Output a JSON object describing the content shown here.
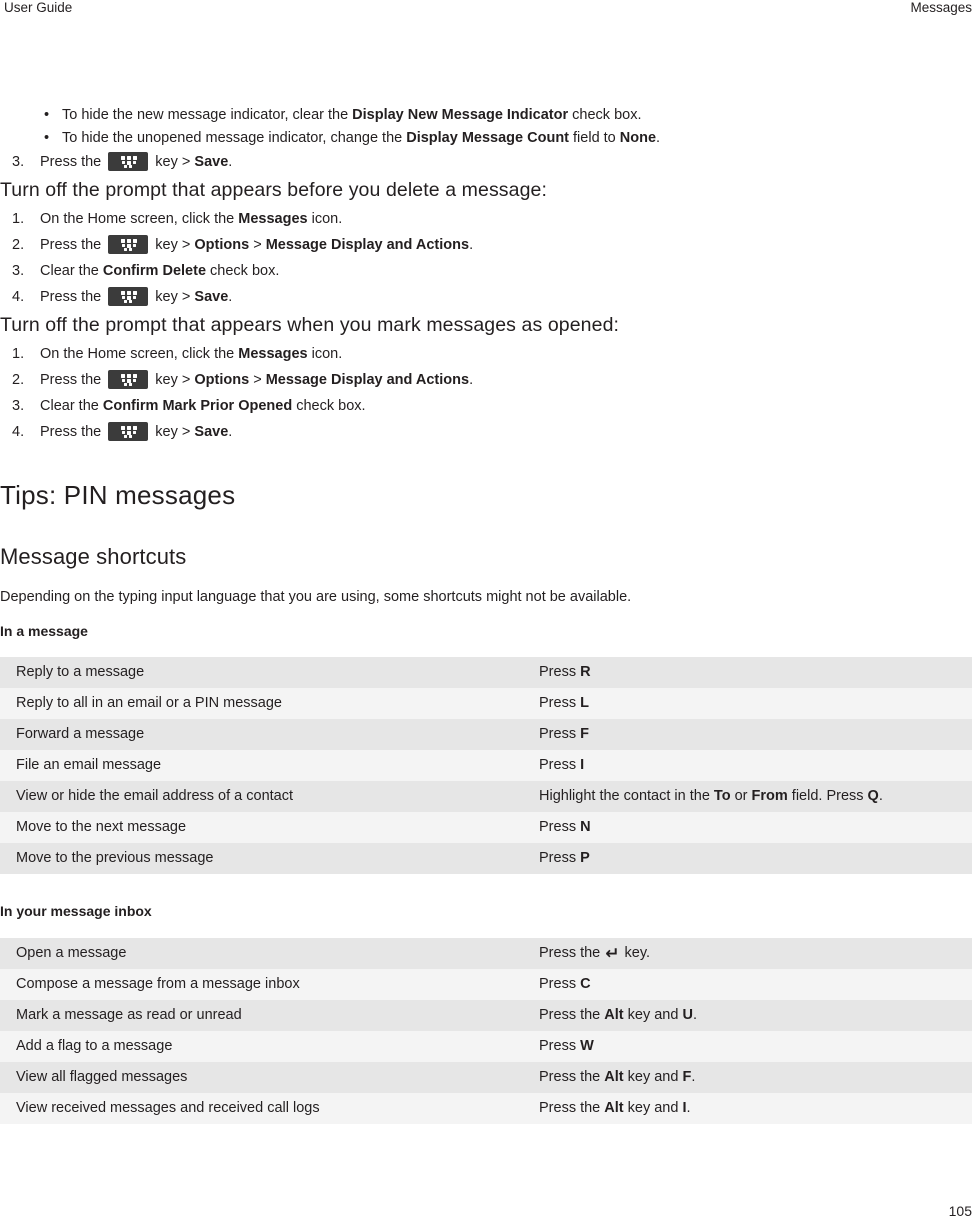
{
  "runhead": {
    "left": "User Guide",
    "right": "Messages"
  },
  "intro_bullets": [
    {
      "pre": "To hide the new message indicator, clear the ",
      "bold": "Display New Message Indicator",
      "post": " check box."
    },
    {
      "pre": "To hide the unopened message indicator, change the ",
      "bold": "Display Message Count",
      "mid": " field to ",
      "bold2": "None",
      "post": "."
    }
  ],
  "intro_step": {
    "num": "3.",
    "pre": "Press the ",
    "icon": "blackberry-menu-key-icon",
    "mid": " key > ",
    "bold": "Save",
    "post": "."
  },
  "procedures": [
    {
      "heading": "Turn off the prompt that appears before you delete a message:",
      "steps": [
        {
          "num": "1.",
          "pre": "On the Home screen, click the ",
          "bold": "Messages",
          "post": " icon.",
          "icon": false
        },
        {
          "num": "2.",
          "pre": "Press the ",
          "icon": true,
          "mid": " key > ",
          "bold": "Options",
          "mid2": " > ",
          "bold2": "Message Display and Actions",
          "post": "."
        },
        {
          "num": "3.",
          "pre": "Clear the ",
          "bold": "Confirm Delete",
          "post": " check box.",
          "icon": false
        },
        {
          "num": "4.",
          "pre": "Press the ",
          "icon": true,
          "mid": " key > ",
          "bold": "Save",
          "post": "."
        }
      ]
    },
    {
      "heading": "Turn off the prompt that appears when you mark messages as opened:",
      "steps": [
        {
          "num": "1.",
          "pre": "On the Home screen, click the ",
          "bold": "Messages",
          "post": " icon.",
          "icon": false
        },
        {
          "num": "2.",
          "pre": "Press the ",
          "icon": true,
          "mid": " key > ",
          "bold": "Options",
          "mid2": " > ",
          "bold2": "Message Display and Actions",
          "post": "."
        },
        {
          "num": "3.",
          "pre": "Clear the ",
          "bold": "Confirm Mark Prior Opened",
          "post": " check box.",
          "icon": false
        },
        {
          "num": "4.",
          "pre": "Press the ",
          "icon": true,
          "mid": " key > ",
          "bold": "Save",
          "post": "."
        }
      ]
    }
  ],
  "section": {
    "title": "Tips: PIN messages",
    "subtitle": "Message shortcuts",
    "paragraph": "Depending on the typing input language that you are using, some shortcuts might not be available."
  },
  "table1": {
    "caption": "In a message",
    "rows": [
      {
        "action": "Reply to a message",
        "pre": "Press ",
        "bold": "R",
        "post": ""
      },
      {
        "action": "Reply to all in an email or a PIN message",
        "pre": "Press ",
        "bold": "L",
        "post": ""
      },
      {
        "action": "Forward a message",
        "pre": "Press ",
        "bold": "F",
        "post": ""
      },
      {
        "action": "File an email message",
        "pre": "Press ",
        "bold": "I",
        "post": ""
      },
      {
        "action": "View or hide the email address of a contact",
        "pre": "Highlight the contact in the ",
        "bold": "To",
        "mid": " or ",
        "bold2": "From",
        "mid2": " field. Press ",
        "bold3": "Q",
        "post": "."
      },
      {
        "action": "Move to the next message",
        "pre": "Press ",
        "bold": "N",
        "post": ""
      },
      {
        "action": "Move to the previous message",
        "pre": "Press ",
        "bold": "P",
        "post": ""
      }
    ]
  },
  "table2": {
    "caption": "In your message inbox",
    "rows": [
      {
        "action": "Open a message",
        "pre": "Press the ",
        "enter_icon": "enter-key-icon",
        "post": " key."
      },
      {
        "action": "Compose a message from a message inbox",
        "pre": "Press ",
        "bold": "C",
        "post": ""
      },
      {
        "action": "Mark a message as read or unread",
        "pre": "Press the ",
        "bold": "Alt",
        "mid": " key and ",
        "bold2": "U",
        "post": "."
      },
      {
        "action": "Add a flag to a message",
        "pre": "Press ",
        "bold": "W",
        "post": ""
      },
      {
        "action": "View all flagged messages",
        "pre": "Press the ",
        "bold": "Alt",
        "mid": " key and ",
        "bold2": "F",
        "post": "."
      },
      {
        "action": "View received messages and received call logs",
        "pre": "Press the ",
        "bold": "Alt",
        "mid": " key and ",
        "bold2": "I",
        "post": "."
      }
    ]
  },
  "footer": {
    "page_number": "105"
  }
}
